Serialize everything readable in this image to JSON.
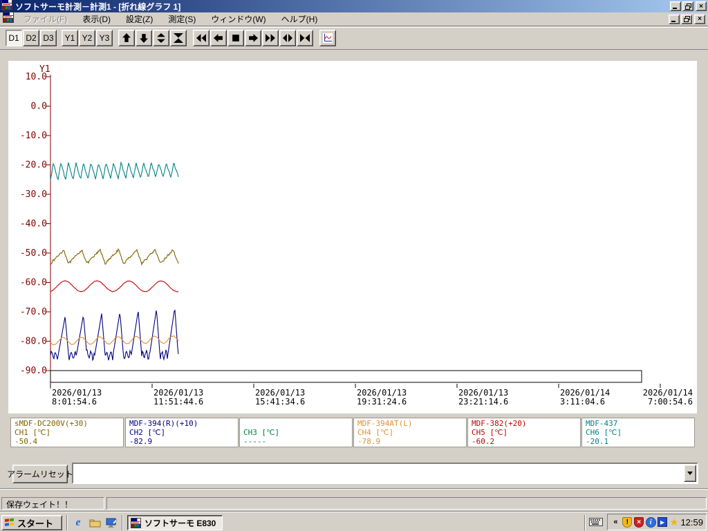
{
  "window": {
    "title": "ソフトサーモ計測－計測1 - [折れ線グラフ 1]"
  },
  "menu": {
    "items": [
      {
        "label": "ファイル(F)",
        "disabled": true
      },
      {
        "label": "表示(D)",
        "disabled": false
      },
      {
        "label": "設定(Z)",
        "disabled": false
      },
      {
        "label": "測定(S)",
        "disabled": false
      },
      {
        "label": "ウィンドウ(W)",
        "disabled": false
      },
      {
        "label": "ヘルプ(H)",
        "disabled": false
      }
    ]
  },
  "toolbar": {
    "d_buttons": [
      "D1",
      "D2",
      "D3"
    ],
    "y_buttons": [
      "Y1",
      "Y2",
      "Y3"
    ],
    "active_button": "D1",
    "icon_buttons": [
      "move-up",
      "move-down",
      "expand-vertical",
      "collapse-vertical",
      "rewind",
      "step-back",
      "stop",
      "step-forward",
      "fast-forward",
      "expand-horizontal",
      "collapse-horizontal",
      "line-graph"
    ]
  },
  "chart_data": {
    "type": "line",
    "title": "折れ線グラフ 1",
    "y_axis": {
      "label": "Y1",
      "max": 10.0,
      "min": -90.0,
      "tick_step": 10.0,
      "color": "#800000",
      "tick_labels": [
        "10.0",
        "0.0",
        "-10.0",
        "-20.0",
        "-30.0",
        "-40.0",
        "-50.0",
        "-60.0",
        "-70.0",
        "-80.0",
        "-90.0"
      ]
    },
    "x_axis": {
      "tick_labels": [
        [
          "2026/01/13",
          "8:01:54.6"
        ],
        [
          "2026/01/13",
          "11:51:44.6"
        ],
        [
          "2026/01/13",
          "15:41:34.6"
        ],
        [
          "2026/01/13",
          "19:31:24.6"
        ],
        [
          "2026/01/13",
          "23:21:14.6"
        ],
        [
          "2026/01/14",
          "3:11:04.6"
        ],
        [
          "2026/01/14",
          "7:00:54.6"
        ]
      ]
    },
    "plotted_fraction": 0.215,
    "series": [
      {
        "name": "sMDF-DC200V(+30)",
        "channel": "CH1",
        "unit": "℃",
        "current": -50.4,
        "color": "#806000",
        "shape": "sawtooth",
        "y_min": -53.6,
        "y_max": -48.9,
        "cycles": 7,
        "noise": 0.8
      },
      {
        "name": "MDF-394(R)(+10)",
        "channel": "CH2",
        "unit": "℃",
        "current": -82.9,
        "color": "#000080",
        "shape": "pulse",
        "y_min": -86.0,
        "y_max": -68.5,
        "cycles": 7,
        "noise": 1.2
      },
      {
        "name": "",
        "channel": "CH3",
        "unit": "℃",
        "current": null,
        "color": "#008040",
        "shape": "none",
        "y_min": null,
        "y_max": null,
        "cycles": 0,
        "noise": 0
      },
      {
        "name": "MDF-394AT(L)",
        "channel": "CH4",
        "unit": "℃",
        "current": -78.9,
        "color": "#e09030",
        "shape": "sine",
        "y_min": -81.2,
        "y_max": -78.8,
        "cycles": 7,
        "noise": 0.2,
        "phase": 3.5,
        "drift": 0.6
      },
      {
        "name": "MDF-382(+20)",
        "channel": "CH5",
        "unit": "℃",
        "current": -60.2,
        "color": "#c00000",
        "shape": "sine",
        "y_min": -63.1,
        "y_max": -59.5,
        "cycles": 4,
        "noise": 0.15,
        "phase": -1.3,
        "drift": 0.0
      },
      {
        "name": "MDF-437",
        "channel": "CH6",
        "unit": "℃",
        "current": -20.1,
        "color": "#008080",
        "shape": "zigzag",
        "y_min": -25.2,
        "y_max": -19.3,
        "cycles": 17,
        "noise": 0.6
      }
    ]
  },
  "legend": {
    "channels": [
      {
        "name": "sMDF-DC200V(+30)",
        "label": "CH1 [℃]",
        "value": "-50.4",
        "color": "#806000"
      },
      {
        "name": "MDF-394(R)(+10)",
        "label": "CH2 [℃]",
        "value": "-82.9",
        "color": "#000080"
      },
      {
        "name": "",
        "label": "CH3 [℃]",
        "value": "-----",
        "color": "#008040"
      },
      {
        "name": "MDF-394AT(L)",
        "label": "CH4 [℃]",
        "value": "-78.9",
        "color": "#e09030"
      },
      {
        "name": "MDF-382(+20)",
        "label": "CH5 [℃]",
        "value": "-60.2",
        "color": "#c00000"
      },
      {
        "name": "MDF-437",
        "label": "CH6 [℃]",
        "value": "-20.1",
        "color": "#008080"
      }
    ]
  },
  "alarm": {
    "reset_label": "アラームリセット",
    "combo_value": ""
  },
  "status_bar": {
    "message": "保存ウェイト！！"
  },
  "taskbar": {
    "start_label": "スタート",
    "task_label": "ソフトサーモ E830",
    "clock": "12:59",
    "tray_icons": [
      "chevron-left",
      "shield-warning",
      "shield-error",
      "info-balloon",
      "play-button",
      "star"
    ]
  }
}
